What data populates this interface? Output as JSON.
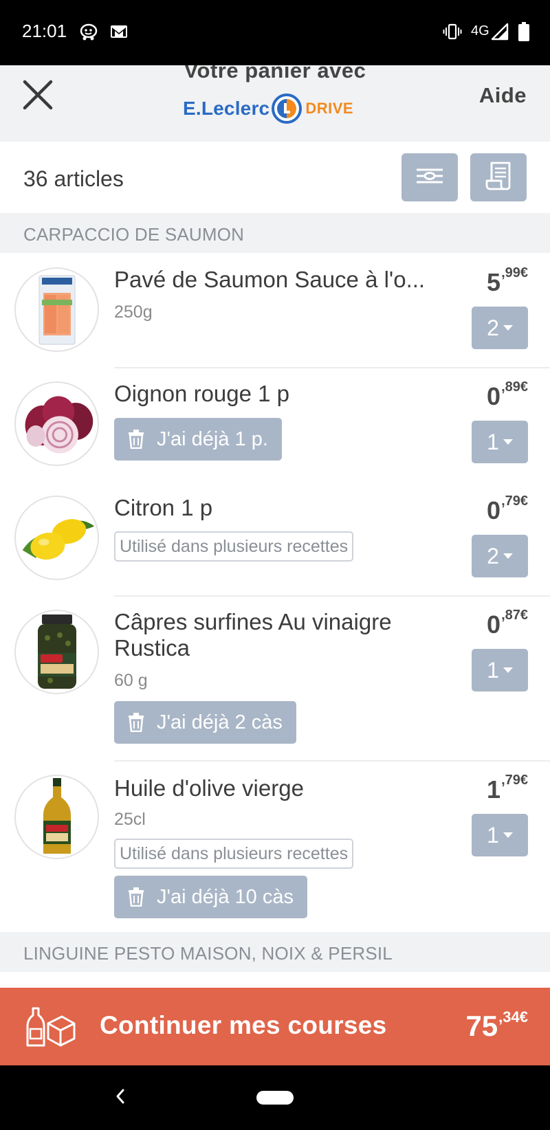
{
  "status_bar": {
    "time": "21:01",
    "network": "4G",
    "left_icons": [
      "waze-icon",
      "gmail-icon"
    ],
    "right_icons": [
      "vibrate-icon",
      "signal-icon",
      "battery-icon"
    ]
  },
  "header": {
    "title": "Votre panier avec",
    "logo_brand": "E.Leclerc",
    "logo_drive": "DRIVE",
    "help_label": "Aide",
    "close_icon": "close-icon"
  },
  "toolbar": {
    "article_count": "36 articles",
    "filter_icon": "filter-icon",
    "receipt_icon": "receipt-icon"
  },
  "sections": [
    {
      "title": "CARPACCIO DE SAUMON"
    },
    {
      "title": "LINGUINE PESTO MAISON, NOIX & PERSIL"
    }
  ],
  "items": [
    {
      "name": "Pavé de Saumon Sauce à l'oseille",
      "name_display": "Pavé de Saumon Sauce à l'o...",
      "quantity_text": "250g",
      "price_int": "5",
      "price_dec": ",99€",
      "qty": "2"
    },
    {
      "name": "Oignon rouge 1 p",
      "price_int": "0",
      "price_dec": ",89€",
      "qty": "1",
      "have_label": "J'ai déjà 1 p."
    },
    {
      "name": "Citron 1 p",
      "tag": "Utilisé dans plusieurs recettes",
      "price_int": "0",
      "price_dec": ",79€",
      "qty": "2"
    },
    {
      "name": "Câpres surfines Au vinaigre Rustica",
      "quantity_text": "60 g",
      "price_int": "0",
      "price_dec": ",87€",
      "qty": "1",
      "have_label": "J'ai déjà 2 càs"
    },
    {
      "name": "Huile d'olive vierge",
      "quantity_text": "25cl",
      "tag": "Utilisé dans plusieurs recettes",
      "price_int": "1",
      "price_dec": ",79€",
      "qty": "1",
      "have_label": "J'ai déjà 10 càs"
    }
  ],
  "cta": {
    "label": "Continuer mes courses",
    "total_int": "75",
    "total_dec": ",34€",
    "icon": "groceries-icon"
  },
  "nav": {
    "back_icon": "back-icon",
    "home_icon": "home-pill-icon"
  },
  "colors": {
    "accent": "#e0654a",
    "button_grey_blue": "#a9b6c7",
    "brand_blue": "#2a6bc4",
    "brand_orange": "#f28a1e",
    "section_bg": "#f1f2f4"
  }
}
